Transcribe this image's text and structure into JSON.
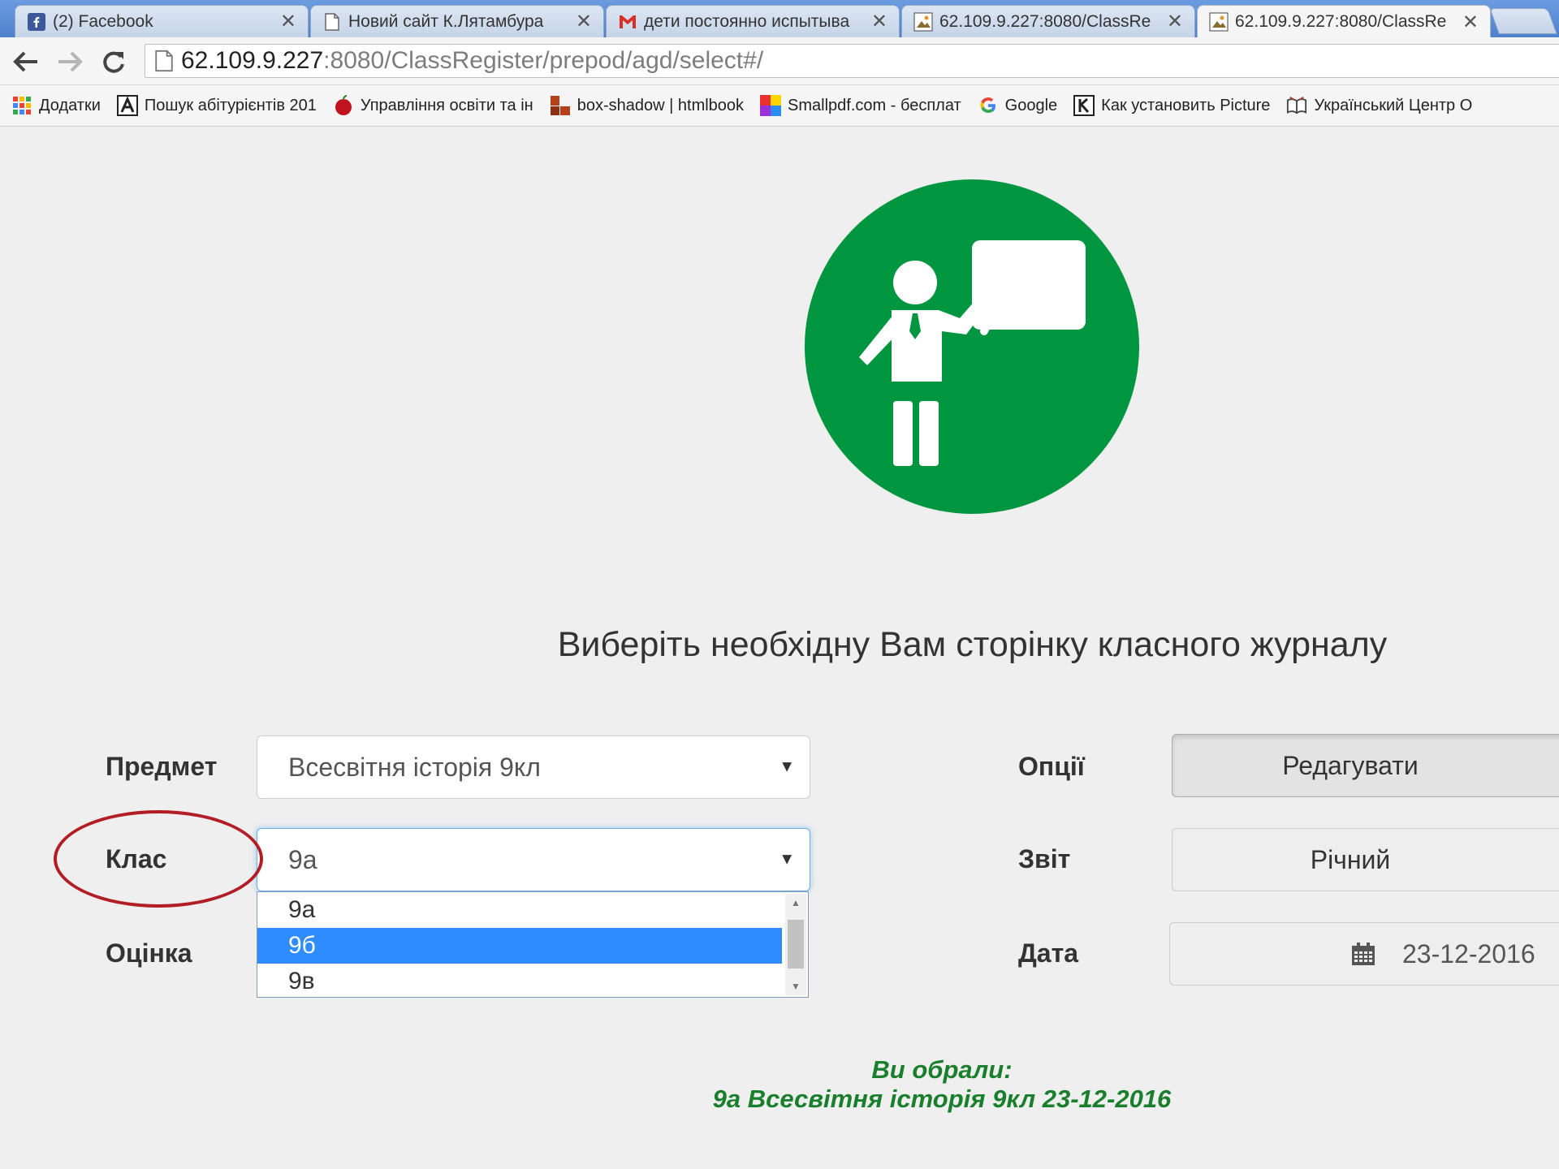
{
  "browser": {
    "tabs": [
      {
        "title": "(2) Facebook",
        "icon": "facebook-icon"
      },
      {
        "title": "Новий сайт К.Лятамбура",
        "icon": "page-icon"
      },
      {
        "title": "дети постоянно испытыва",
        "icon": "gmail-icon"
      },
      {
        "title": "62.109.9.227:8080/ClassRe",
        "icon": "classregister-icon"
      },
      {
        "title": "62.109.9.227:8080/ClassRe",
        "icon": "classregister-icon"
      }
    ],
    "close_glyph": "✕",
    "url_host": "62.109.9.227",
    "url_rest": ":8080/ClassRegister/prepod/agd/select#/",
    "bookmarks": [
      {
        "label": "Додатки",
        "icon": "apps-icon"
      },
      {
        "label": "Пошук абітурієнтів 201",
        "icon": "a-letter-icon"
      },
      {
        "label": "Управління освіти та ін",
        "icon": "apple-icon"
      },
      {
        "label": "box-shadow | htmlbook",
        "icon": "bricks-icon"
      },
      {
        "label": "Smallpdf.com - бесплат",
        "icon": "smallpdf-icon"
      },
      {
        "label": "Google",
        "icon": "google-icon"
      },
      {
        "label": "Как установить Picture",
        "icon": "k-letter-icon"
      },
      {
        "label": "Український Центр О",
        "icon": "book-icon"
      }
    ]
  },
  "colors": {
    "brand_green": "#009640",
    "result_green": "#1a7f2c",
    "selection_blue": "#2f8cff",
    "annotation_red": "#b31d25"
  },
  "page": {
    "heading": "Виберіть необхідну Вам сторінку класного журналу",
    "form": {
      "subject_label": "Предмет",
      "subject_value": "Всесвітня історія 9кл",
      "class_label": "Клас",
      "class_value": "9а",
      "class_options": [
        "9а",
        "9б",
        "9в"
      ],
      "class_highlighted": "9б",
      "grade_label": "Оцінка",
      "options_label": "Опції",
      "options_button": "Редагувати",
      "report_label": "Звіт",
      "report_button": "Річний",
      "date_label": "Дата",
      "date_value": "23-12-2016",
      "caret": "▼"
    },
    "result": {
      "line1": "Ви обрали:",
      "line2": "9а Всесвітня історія 9кл 23-12-2016"
    }
  }
}
